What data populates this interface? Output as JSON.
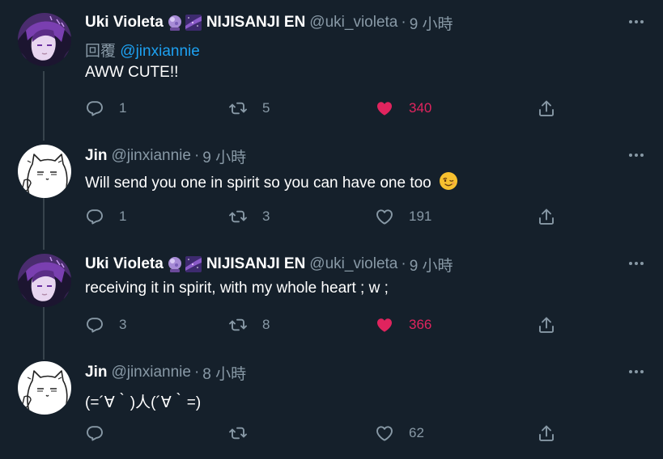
{
  "tweets": [
    {
      "name": "Uki Violeta",
      "org": "NIJISANJI EN",
      "handle": "@uki_violeta",
      "dot": "·",
      "time": "9 小時",
      "reply_prefix": "回覆",
      "reply_mention": "@jinxiannie",
      "text": "AWW CUTE!!",
      "replies": "1",
      "retweets": "5",
      "likes": "340",
      "liked": true,
      "avatar": "uki-avatar"
    },
    {
      "name": "Jin",
      "handle": "@jinxiannie",
      "dot": "·",
      "time": "9 小時",
      "text": "Will send you one in spirit so you can have one too",
      "text_emoji": "winking-face-emoji",
      "replies": "1",
      "retweets": "3",
      "likes": "191",
      "liked": false,
      "avatar": "jin-cat-avatar"
    },
    {
      "name": "Uki Violeta",
      "org": "NIJISANJI EN",
      "handle": "@uki_violeta",
      "dot": "·",
      "time": "9 小時",
      "text": "receiving it in spirit, with my whole heart ; w ;",
      "replies": "3",
      "retweets": "8",
      "likes": "366",
      "liked": true,
      "avatar": "uki-avatar"
    },
    {
      "name": "Jin",
      "handle": "@jinxiannie",
      "dot": "·",
      "time": "8 小時",
      "text": "(=´∀｀)人(´∀｀=)",
      "replies": "",
      "retweets": "",
      "likes": "62",
      "liked": false,
      "avatar": "jin-cat-avatar"
    }
  ],
  "colors": {
    "background": "#15202b",
    "muted": "#8899a6",
    "link": "#1da1f2",
    "like": "#e0245e",
    "thread_line": "#38444d"
  }
}
